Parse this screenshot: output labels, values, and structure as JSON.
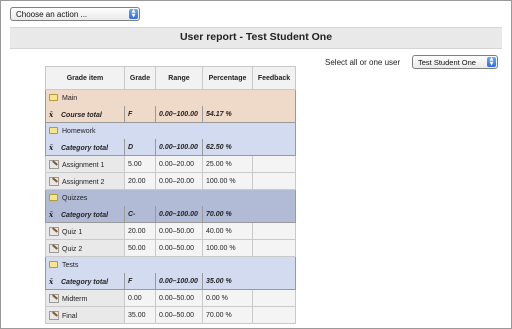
{
  "action_select": {
    "value": "Choose an action ..."
  },
  "report_title": "User report - Test Student One",
  "student_select": {
    "label": "Select all or one user",
    "value": "Test Student One"
  },
  "table": {
    "headers": [
      "Grade item",
      "Grade",
      "Range",
      "Percentage",
      "Feedback"
    ],
    "rows": [
      {
        "kind": "category",
        "style": "main",
        "name": "Main"
      },
      {
        "kind": "total",
        "style": "main",
        "name": "Course total",
        "grade": "F",
        "range": "0.00–100.00",
        "percentage": "54.17 %"
      },
      {
        "kind": "category",
        "style": "hw",
        "name": "Homework"
      },
      {
        "kind": "total",
        "style": "hw",
        "name": "Category total",
        "grade": "D",
        "range": "0.00–100.00",
        "percentage": "62.50 %"
      },
      {
        "kind": "item",
        "name": "Assignment 1",
        "grade": "5.00",
        "range": "0.00–20.00",
        "percentage": "25.00 %",
        "feedback": ""
      },
      {
        "kind": "item",
        "name": "Assignment 2",
        "grade": "20.00",
        "range": "0.00–20.00",
        "percentage": "100.00 %",
        "feedback": ""
      },
      {
        "kind": "category",
        "style": "qz",
        "name": "Quizzes"
      },
      {
        "kind": "total",
        "style": "qz",
        "name": "Category total",
        "grade": "C-",
        "range": "0.00–100.00",
        "percentage": "70.00 %"
      },
      {
        "kind": "item",
        "name": "Quiz 1",
        "grade": "20.00",
        "range": "0.00–50.00",
        "percentage": "40.00 %",
        "feedback": ""
      },
      {
        "kind": "item",
        "name": "Quiz 2",
        "grade": "50.00",
        "range": "0.00–50.00",
        "percentage": "100.00 %",
        "feedback": ""
      },
      {
        "kind": "category",
        "style": "te",
        "name": "Tests"
      },
      {
        "kind": "total",
        "style": "te",
        "name": "Category total",
        "grade": "F",
        "range": "0.00–100.00",
        "percentage": "35.00 %"
      },
      {
        "kind": "item",
        "name": "Midterm",
        "grade": "0.00",
        "range": "0.00–50.00",
        "percentage": "0.00 %",
        "feedback": ""
      },
      {
        "kind": "item",
        "name": "Final",
        "grade": "35.00",
        "range": "0.00–50.00",
        "percentage": "70.00 %",
        "feedback": ""
      }
    ]
  },
  "icons": {
    "category": "folder-icon",
    "total": "aggregate-xbar-icon",
    "item": "assignment-icon",
    "select": "select-arrows-icon"
  }
}
